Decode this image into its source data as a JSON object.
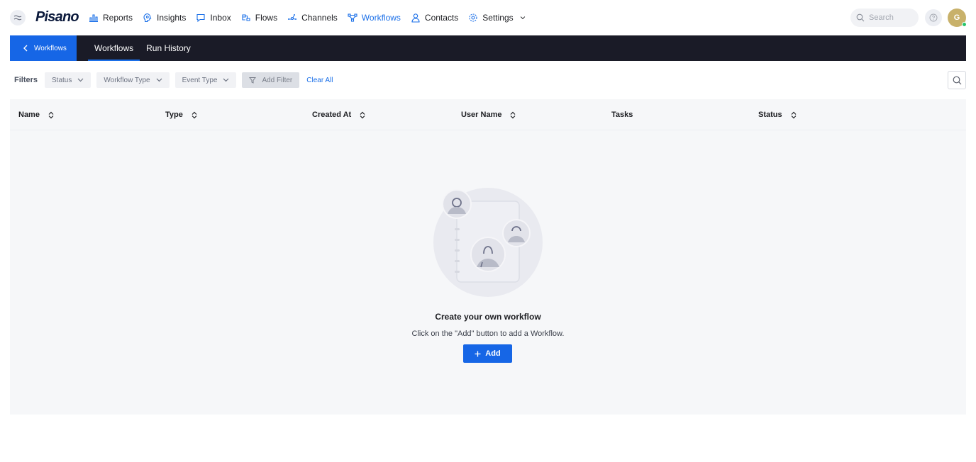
{
  "app": {
    "logo": "Pisano"
  },
  "nav": {
    "items": [
      {
        "label": "Reports",
        "icon": "bar-chart-icon",
        "active": false
      },
      {
        "label": "Insights",
        "icon": "insights-icon",
        "active": false
      },
      {
        "label": "Inbox",
        "icon": "chat-icon",
        "active": false
      },
      {
        "label": "Flows",
        "icon": "flows-icon",
        "active": false
      },
      {
        "label": "Channels",
        "icon": "channels-icon",
        "active": false
      },
      {
        "label": "Workflows",
        "icon": "workflows-icon",
        "active": true
      },
      {
        "label": "Contacts",
        "icon": "contact-icon",
        "active": false
      },
      {
        "label": "Settings",
        "icon": "gear-icon",
        "active": false
      }
    ],
    "search_placeholder": "Search",
    "avatar_initial": "G"
  },
  "subbar": {
    "back_label": "Workflows",
    "tabs": [
      {
        "label": "Workflows",
        "active": true
      },
      {
        "label": "Run History",
        "active": false
      }
    ]
  },
  "filters": {
    "label": "Filters",
    "dropdowns": [
      "Status",
      "Workflow Type",
      "Event Type"
    ],
    "add_filter": "Add Filter",
    "clear_all": "Clear All"
  },
  "table": {
    "columns": [
      {
        "label": "Name",
        "sortable": true
      },
      {
        "label": "Type",
        "sortable": true
      },
      {
        "label": "Created At",
        "sortable": true
      },
      {
        "label": "User Name",
        "sortable": true
      },
      {
        "label": "Tasks",
        "sortable": false
      },
      {
        "label": "Status",
        "sortable": true
      }
    ]
  },
  "empty_state": {
    "title": "Create your own workflow",
    "subtitle": "Click on the \"Add\" button to add a Workflow.",
    "add_label": "Add"
  },
  "colors": {
    "accent": "#1666e6",
    "dark_bar": "#1a1b27",
    "avatar": "#c8b16a",
    "online": "#27c46b"
  }
}
